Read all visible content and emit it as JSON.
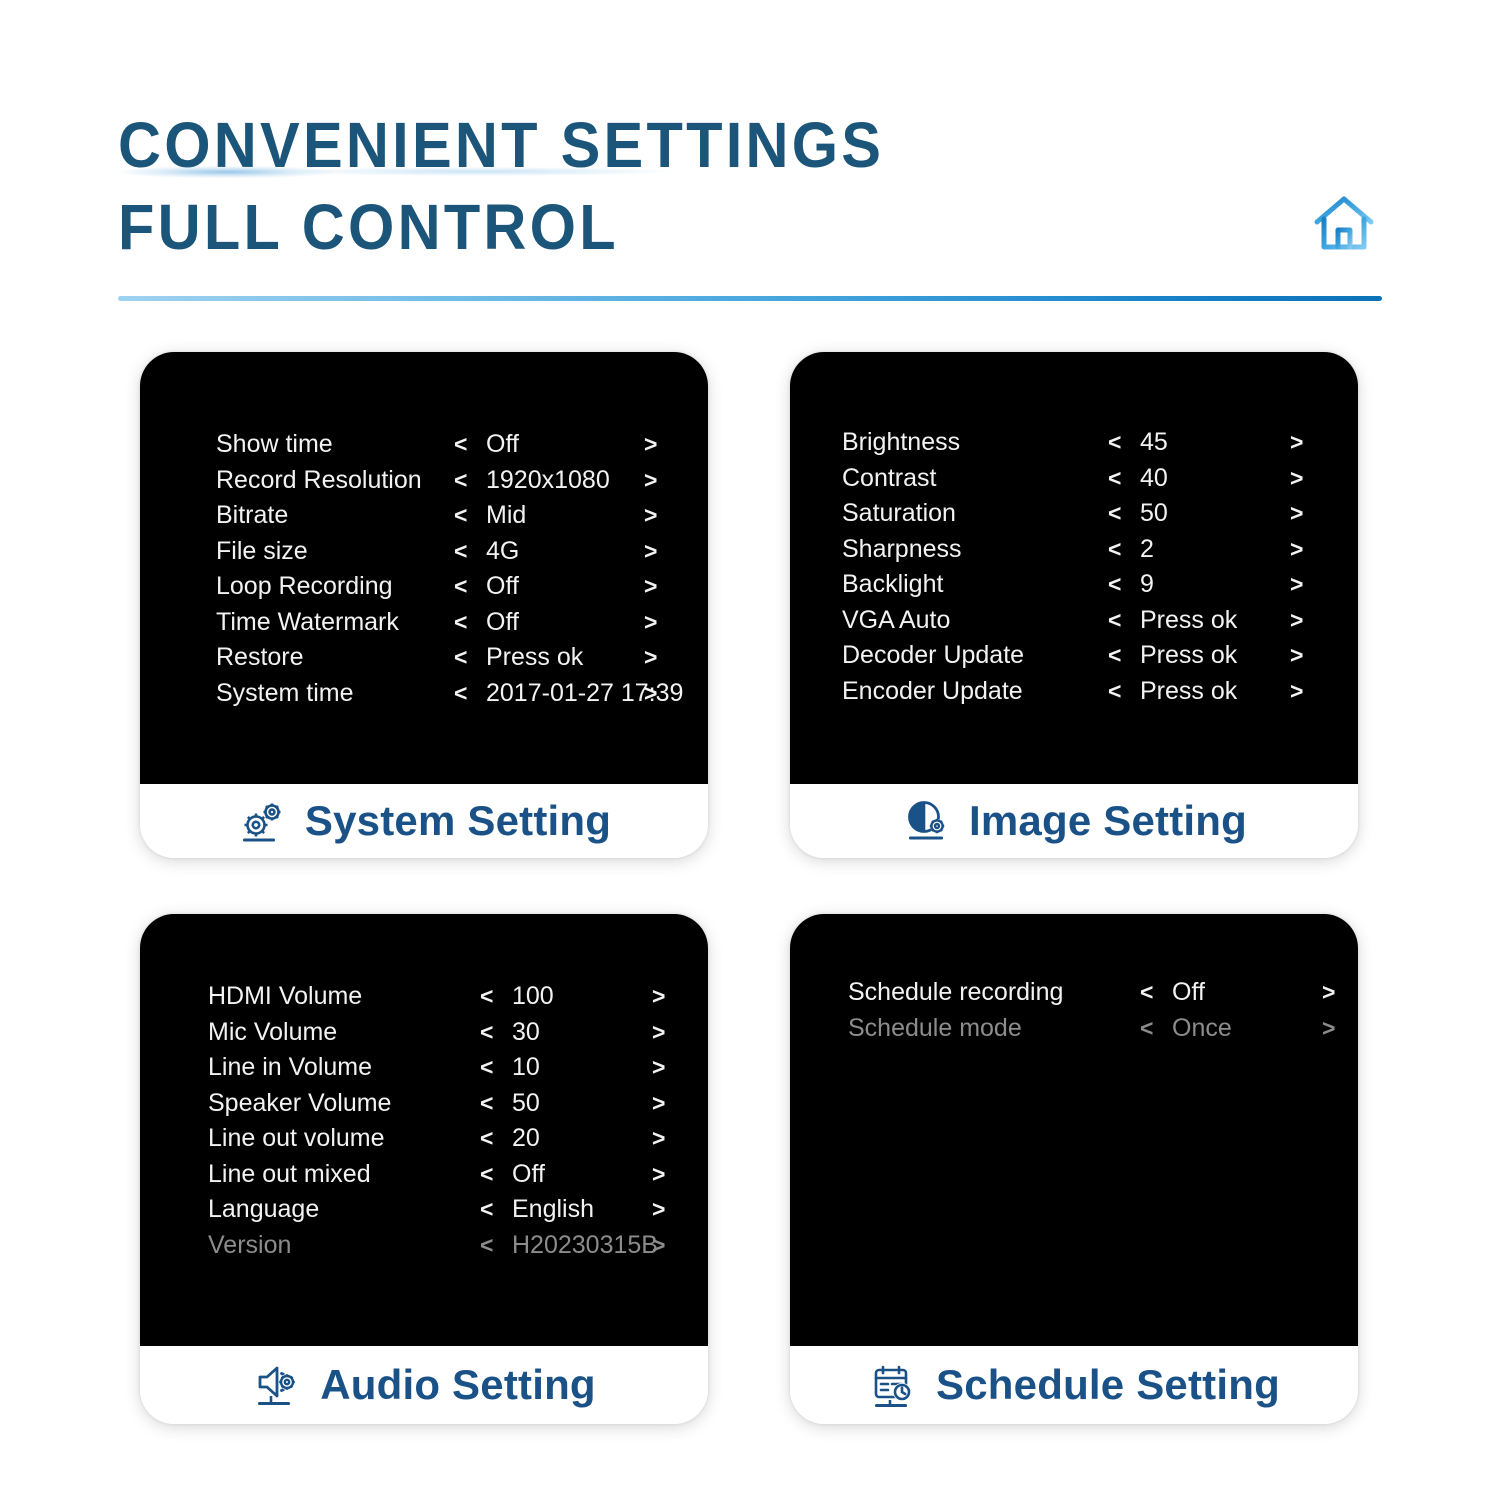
{
  "header": {
    "title_line1": "CONVENIENT SETTINGS",
    "title_line2": "FULL CONTROL",
    "home_icon": "home-icon",
    "title_color": "#1b5579",
    "divider_from": "#9fd2f0",
    "divider_to": "#0c72b8"
  },
  "colors": {
    "screen_bg": "#000000",
    "screen_text": "#f2f2f2",
    "screen_text_dim": "#8c8c8c",
    "label_blue": "#1a5288",
    "card_bg": "#ffffff"
  },
  "cards": [
    {
      "id": "system-setting",
      "footer_label": "System Setting",
      "footer_icon": "gears-icon",
      "rows": [
        {
          "label": "Show time",
          "prev": "<",
          "value": "Off",
          "next": ">",
          "dim": false,
          "wide": false
        },
        {
          "label": "Record Resolution",
          "prev": "<",
          "value": "1920x1080",
          "next": ">",
          "dim": false,
          "wide": false
        },
        {
          "label": "Bitrate",
          "prev": "<",
          "value": "Mid",
          "next": ">",
          "dim": false,
          "wide": false
        },
        {
          "label": "File size",
          "prev": "<",
          "value": "4G",
          "next": ">",
          "dim": false,
          "wide": false
        },
        {
          "label": "Loop Recording",
          "prev": "<",
          "value": "Off",
          "next": ">",
          "dim": false,
          "wide": false
        },
        {
          "label": "Time Watermark",
          "prev": "<",
          "value": "Off",
          "next": ">",
          "dim": false,
          "wide": false
        },
        {
          "label": "Restore",
          "prev": "<",
          "value": "Press ok",
          "next": ">",
          "dim": false,
          "wide": true
        },
        {
          "label": "System time",
          "prev": "<",
          "value": "2017-01-27 17:39",
          "next": ">",
          "dim": false,
          "wide": true
        }
      ]
    },
    {
      "id": "image-setting",
      "footer_label": "Image Setting",
      "footer_icon": "contrast-gear-icon",
      "rows": [
        {
          "label": "Brightness",
          "prev": "<",
          "value": "45",
          "next": ">",
          "dim": false,
          "wide": false
        },
        {
          "label": "Contrast",
          "prev": "<",
          "value": "40",
          "next": ">",
          "dim": false,
          "wide": false
        },
        {
          "label": "Saturation",
          "prev": "<",
          "value": "50",
          "next": ">",
          "dim": false,
          "wide": false
        },
        {
          "label": "Sharpness",
          "prev": "<",
          "value": "2",
          "next": ">",
          "dim": false,
          "wide": false
        },
        {
          "label": "Backlight",
          "prev": "<",
          "value": "9",
          "next": ">",
          "dim": false,
          "wide": false
        },
        {
          "label": "VGA Auto",
          "prev": "<",
          "value": "Press ok",
          "next": ">",
          "dim": false,
          "wide": true
        },
        {
          "label": "Decoder Update",
          "prev": "<",
          "value": "Press ok",
          "next": ">",
          "dim": false,
          "wide": true
        },
        {
          "label": "Encoder Update",
          "prev": "<",
          "value": "Press ok",
          "next": ">",
          "dim": false,
          "wide": true
        }
      ]
    },
    {
      "id": "audio-setting",
      "footer_label": "Audio Setting",
      "footer_icon": "speaker-gear-icon",
      "rows": [
        {
          "label": "HDMI Volume",
          "prev": "<",
          "value": "100",
          "next": ">",
          "dim": false,
          "wide": false
        },
        {
          "label": "Mic Volume",
          "prev": "<",
          "value": "30",
          "next": ">",
          "dim": false,
          "wide": false
        },
        {
          "label": "Line in Volume",
          "prev": "<",
          "value": "10",
          "next": ">",
          "dim": false,
          "wide": false
        },
        {
          "label": "Speaker Volume",
          "prev": "<",
          "value": "50",
          "next": ">",
          "dim": false,
          "wide": false
        },
        {
          "label": "Line out volume",
          "prev": "<",
          "value": "20",
          "next": ">",
          "dim": false,
          "wide": false
        },
        {
          "label": "Line out mixed",
          "prev": "<",
          "value": "Off",
          "next": ">",
          "dim": false,
          "wide": false
        },
        {
          "label": "Language",
          "prev": "<",
          "value": "English",
          "next": ">",
          "dim": false,
          "wide": false
        },
        {
          "label": "Version",
          "prev": "<",
          "value": "H20230315B",
          "next": ">",
          "dim": true,
          "wide": true
        }
      ]
    },
    {
      "id": "schedule-setting",
      "footer_label": "Schedule Setting",
      "footer_icon": "calendar-clock-icon",
      "rows": [
        {
          "label": "Schedule recording",
          "prev": "<",
          "value": "Off",
          "next": ">",
          "dim": false,
          "wide": false
        },
        {
          "label": "Schedule mode",
          "prev": "<",
          "value": "Once",
          "next": ">",
          "dim": true,
          "wide": false
        }
      ]
    }
  ]
}
